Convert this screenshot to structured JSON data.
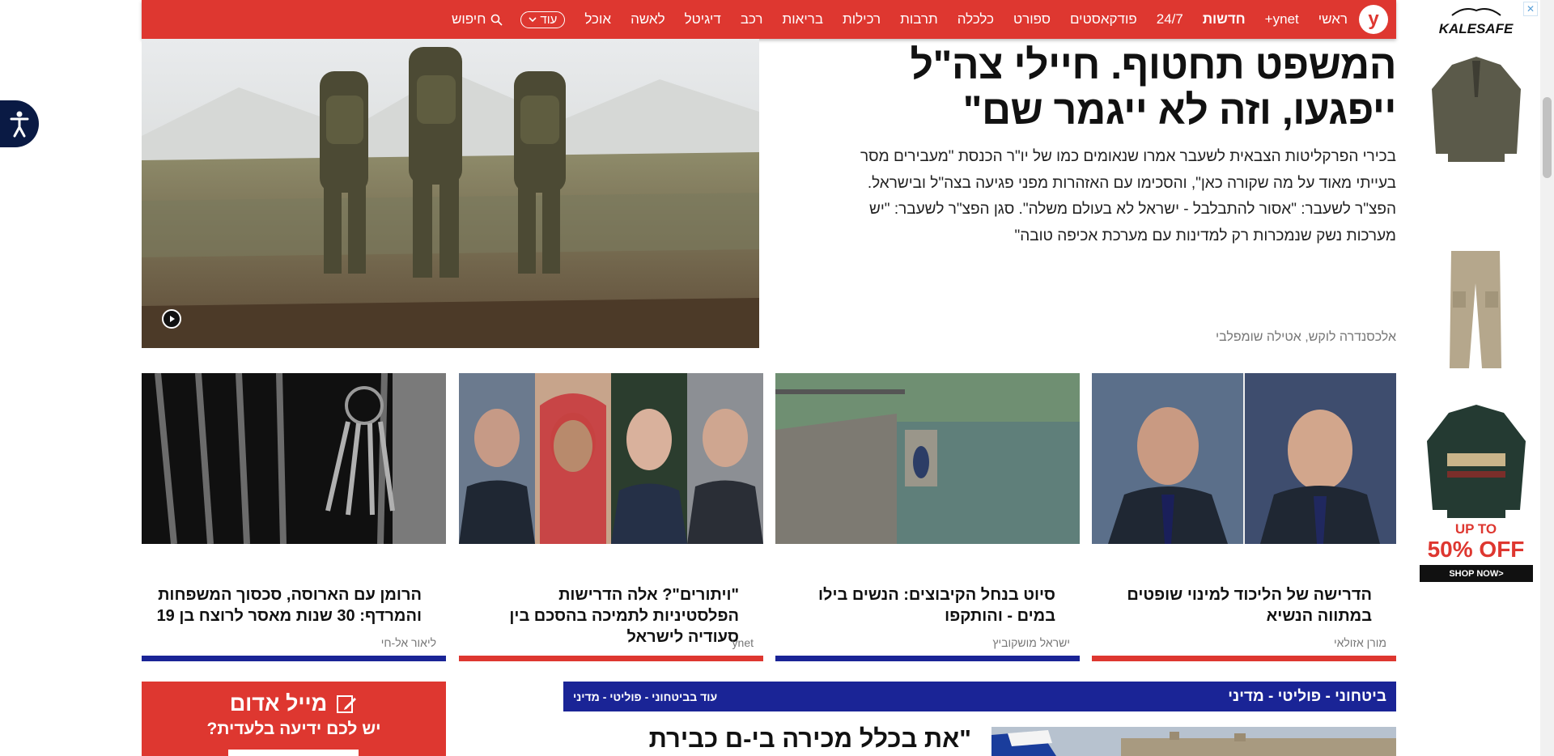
{
  "nav": {
    "logo": "y",
    "items": [
      "ראשי",
      "ynet+",
      "חדשות",
      "24/7",
      "פודקאסטים",
      "ספורט",
      "כלכלה",
      "תרבות",
      "רכילות",
      "בריאות",
      "רכב",
      "דיגיטל",
      "לאשה",
      "אוכל"
    ],
    "more_label": "עוד",
    "search_label": "חיפוש"
  },
  "hero": {
    "title": "המשפט תחטוף. חיילי צה\"ל ייפגעו, וזה לא ייגמר שם\"",
    "subtitle": "בכירי הפרקליטות הצבאית לשעבר אמרו שנאומים כמו של יו\"ר הכנסת \"מעבירים מסר בעייתי מאוד על מה שקורה כאן\", והסכימו עם האזהרות מפני פגיעה בצה\"ל ובישראל. הפצ\"ר לשעבר: \"אסור להתבלבל - ישראל לא בעולם משלה\". סגן הפצ\"ר לשעבר: \"יש מערכות נשק שנמכרות רק למדינות עם מערכת אכיפה טובה\"",
    "author": "אלכסנדרה לוקש, אטילה שומפלבי"
  },
  "cards": [
    {
      "title": "הדרישה של הליכוד למינוי שופטים במתווה הנשיא",
      "author": "מורן אזולאי",
      "bar_color": "#de3730"
    },
    {
      "title": "סיוט בנחל הקיבוצים: הנשים בילו במים - והותקפו",
      "author": "ישראל מושקוביץ",
      "bar_color": "#1a2496"
    },
    {
      "title": "\"ויתורים\"? אלה הדרישות הפלסטיניות לתמיכה בהסכם בין סעודיה לישראל",
      "author": "ynet",
      "bar_color": "#de3730"
    },
    {
      "title": "הרומן עם הארוסה, סכסוך המשפחות והמרדף: 30 שנות מאסר לרוצח בן 19",
      "author": "ליאור אל-חי",
      "bar_color": "#1a2496"
    }
  ],
  "red_mail": {
    "title": "מייל אדום",
    "subtitle": "יש לכם ידיעה בלעדית?"
  },
  "section": {
    "title": "ביטחוני - פוליטי - מדיני",
    "more": "עוד בביטחוני - פוליטי - מדיני",
    "headline": "\"את בכלל מכירה בי-ם כבירת"
  },
  "ad": {
    "brand": "KALESAFE",
    "promo_line1": "UP TO",
    "promo_line2": "50% OFF",
    "shop_label": "SHOP NOW>"
  }
}
